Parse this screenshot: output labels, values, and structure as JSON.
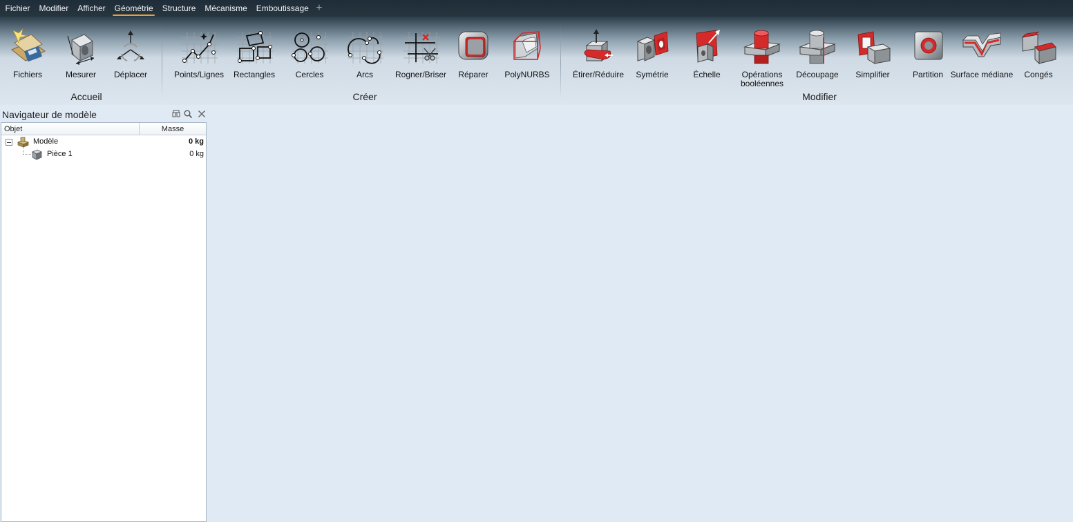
{
  "menubar": {
    "items": [
      {
        "label": "Fichier"
      },
      {
        "label": "Modifier"
      },
      {
        "label": "Afficher"
      },
      {
        "label": "Géométrie",
        "active": true
      },
      {
        "label": "Structure"
      },
      {
        "label": "Mécanisme"
      },
      {
        "label": "Emboutissage"
      }
    ],
    "add_icon": "plus-icon"
  },
  "ribbon": {
    "groups": [
      {
        "label": "Accueil",
        "tools": [
          {
            "label": "Fichiers",
            "icon": "files-icon"
          },
          {
            "label": "Mesurer",
            "icon": "measure-icon"
          },
          {
            "label": "Déplacer",
            "icon": "move-icon"
          }
        ]
      },
      {
        "label": "Créer",
        "tools": [
          {
            "label": "Points/Lignes",
            "icon": "points-lines-icon"
          },
          {
            "label": "Rectangles",
            "icon": "rectangles-icon"
          },
          {
            "label": "Cercles",
            "icon": "circles-icon"
          },
          {
            "label": "Arcs",
            "icon": "arcs-icon"
          },
          {
            "label": "Rogner/Briser",
            "icon": "trim-break-icon"
          },
          {
            "label": "Réparer",
            "icon": "repair-icon"
          },
          {
            "label": "PolyNURBS",
            "icon": "polynurbs-icon"
          }
        ]
      },
      {
        "label": "Modifier",
        "tools": [
          {
            "label": "Étirer/Réduire",
            "icon": "push-pull-icon"
          },
          {
            "label": "Symétrie",
            "icon": "symmetry-icon"
          },
          {
            "label": "Échelle",
            "icon": "scale-icon"
          },
          {
            "label": "Opérations",
            "label2": "booléennes",
            "icon": "boolean-icon"
          },
          {
            "label": "Découpage",
            "icon": "cut-icon"
          },
          {
            "label": "Simplifier",
            "icon": "simplify-icon"
          },
          {
            "label": "Partition",
            "icon": "partition-icon"
          },
          {
            "label": "Surface médiane",
            "icon": "midsurface-icon"
          },
          {
            "label": "Congés",
            "icon": "fillets-icon"
          }
        ]
      }
    ]
  },
  "navigator": {
    "title": "Navigateur de modèle",
    "columns": {
      "object": "Objet",
      "mass": "Masse"
    },
    "rows": [
      {
        "name": "Modèle",
        "mass": "0 kg",
        "bold_mass": true,
        "icon": "model-icon"
      },
      {
        "name": "Pièce 1",
        "mass": "0 kg",
        "bold_mass": false,
        "icon": "part-icon"
      }
    ]
  },
  "colors": {
    "menubar_bg": "#1f2d38",
    "active_underline": "#e9a13c",
    "accent_red": "#d42a2a",
    "workspace_bg": "#e0eaf4"
  }
}
